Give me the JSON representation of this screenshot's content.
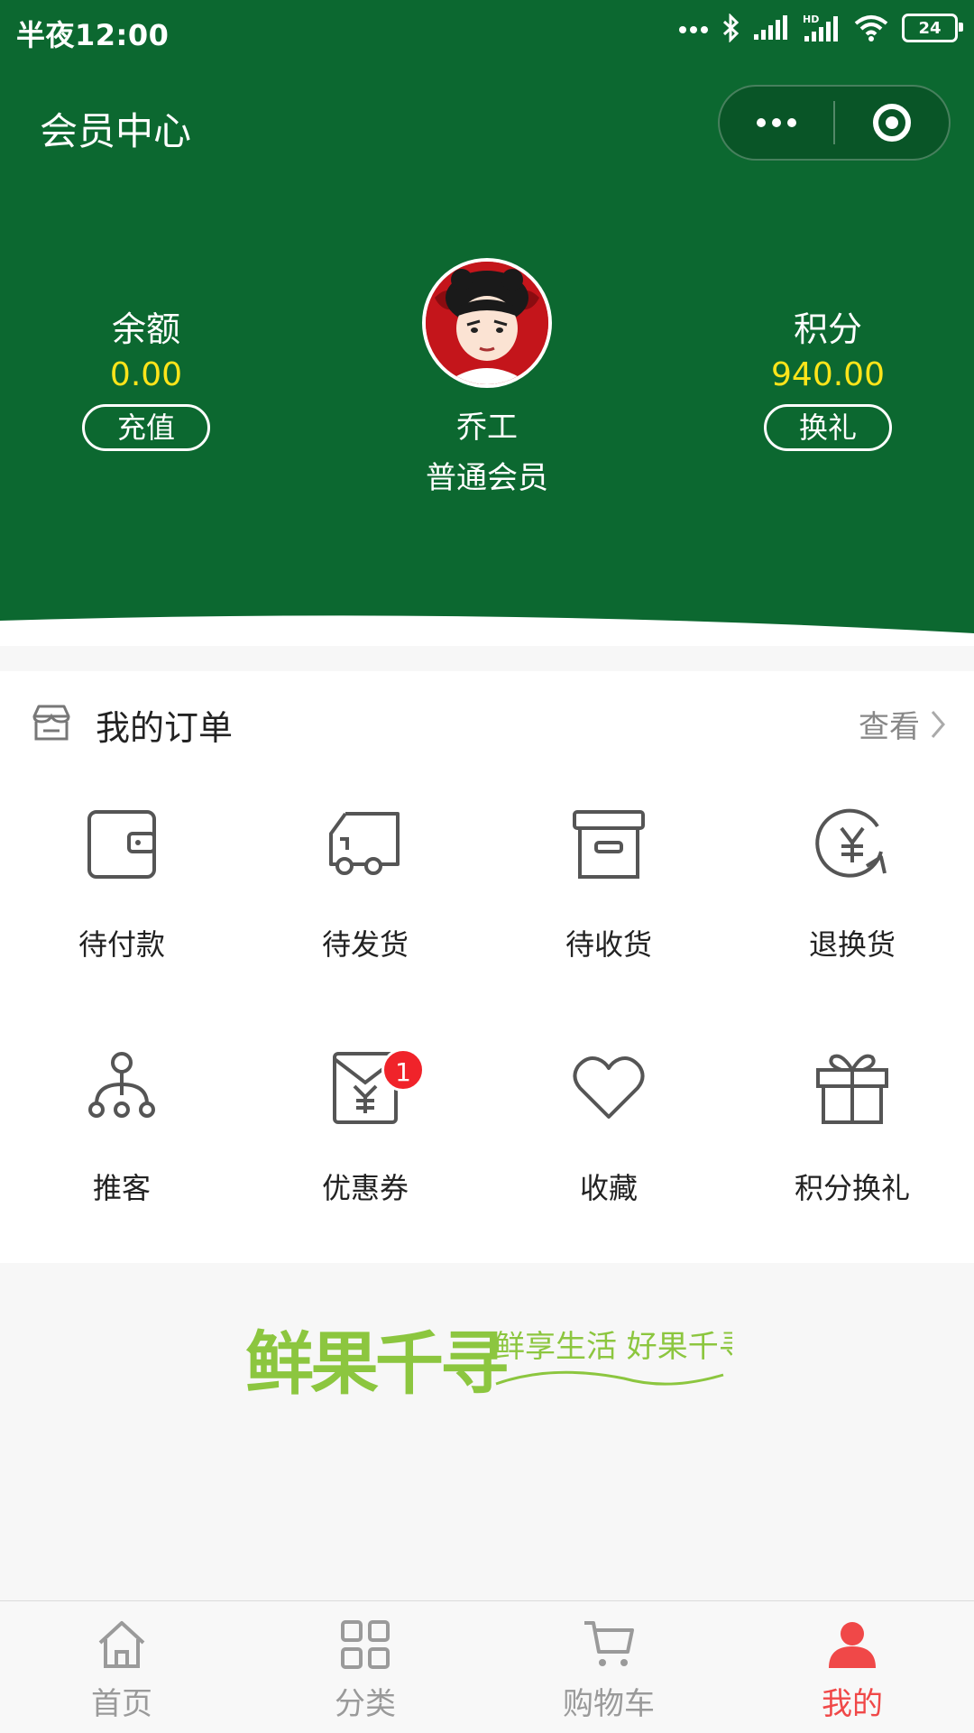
{
  "status_bar": {
    "time": "半夜12:00",
    "battery": "24"
  },
  "header": {
    "title": "会员中心",
    "balance": {
      "label": "余额",
      "value": "0.00",
      "button": "充值"
    },
    "points": {
      "label": "积分",
      "value": "940.00",
      "button": "换礼"
    },
    "user": {
      "name": "乔工",
      "level": "普通会员"
    }
  },
  "orders": {
    "title": "我的订单",
    "view_all": "查看",
    "items": [
      {
        "label": "待付款",
        "icon": "wallet-icon"
      },
      {
        "label": "待发货",
        "icon": "truck-icon"
      },
      {
        "label": "待收货",
        "icon": "box-icon"
      },
      {
        "label": "退换货",
        "icon": "yuan-refresh-icon"
      },
      {
        "label": "推客",
        "icon": "network-icon"
      },
      {
        "label": "优惠券",
        "icon": "coupon-icon",
        "badge": "1"
      },
      {
        "label": "收藏",
        "icon": "heart-icon"
      },
      {
        "label": "积分换礼",
        "icon": "gift-icon"
      }
    ]
  },
  "brand": {
    "name": "鲜果千寻",
    "slogan": "鲜享生活 好果千寻"
  },
  "tabbar": {
    "items": [
      {
        "label": "首页",
        "icon": "home-icon"
      },
      {
        "label": "分类",
        "icon": "grid-icon"
      },
      {
        "label": "购物车",
        "icon": "cart-icon"
      },
      {
        "label": "我的",
        "icon": "user-icon",
        "active": true
      }
    ]
  },
  "colors": {
    "primary": "#0c6830",
    "accent": "#ffe51a",
    "badge": "#f0232a",
    "active_tab": "#f04848"
  }
}
